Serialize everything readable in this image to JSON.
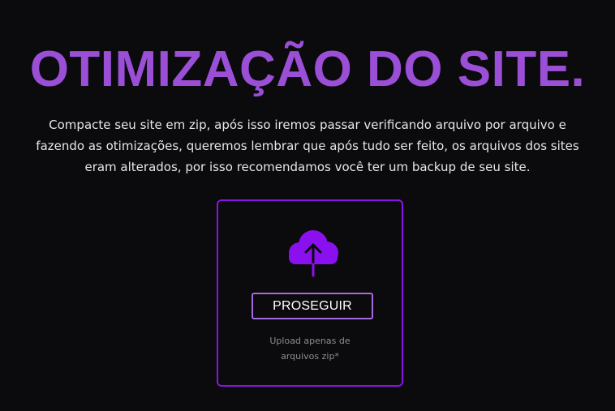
{
  "page": {
    "title": "OTIMIZAÇÃO DO SITE.",
    "description": "Compacte seu site em zip, após isso iremos passar verificando arquivo por arquivo e fazendo as otimizações, queremos lembrar que após tudo ser feito, os arquivos dos sites eram alterados, por isso recomendamos você ter um backup de seu site."
  },
  "upload": {
    "icon": "cloud-upload-icon",
    "button_label": "PROSEGUIR",
    "hint_line1": "Upload apenas de",
    "hint_line2": "arquivos zip*"
  },
  "colors": {
    "background": "#0b0a0c",
    "title": "#9a4fd6",
    "card_border": "#8a12e6",
    "icon": "#8b10f0",
    "button_border": "#a66ae0"
  }
}
